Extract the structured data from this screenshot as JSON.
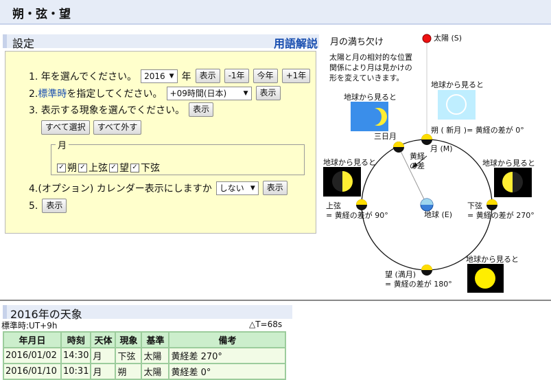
{
  "page": {
    "title": "朔・弦・望"
  },
  "settings": {
    "heading": "設定",
    "glossary_link": "用語解説",
    "step1": {
      "text": "1. 年を選んでください。",
      "year_value": "2016",
      "year_unit": "年",
      "show": "表示",
      "minus1": "-1年",
      "this_year": "今年",
      "plus1": "+1年"
    },
    "step2": {
      "num": "2.",
      "link": "標準時",
      "text": "を指定してください。",
      "tz_value": "+09時間(日本)",
      "show": "表示"
    },
    "step3": {
      "text": "3. 表示する現象を選んでください。",
      "show": "表示",
      "select_all": "すべて選択",
      "deselect_all": "すべて外す",
      "group_legend": "月",
      "options": [
        "朔",
        "上弦",
        "望",
        "下弦"
      ],
      "checked": [
        true,
        true,
        true,
        true
      ]
    },
    "step4": {
      "text": "4.(オプション) カレンダー表示にしますか",
      "value": "しない",
      "show": "表示"
    },
    "step5": {
      "num": "5.",
      "show": "表示"
    }
  },
  "diagram": {
    "title": "月の満ち欠け",
    "desc": [
      "太陽と月の相対的な位置",
      "関係により月は見かけの",
      "形を変えていきます。"
    ],
    "sun_label": "太陽 (S)",
    "view_from_earth": "地球から見ると",
    "new_moon": "朔 ( 新月 )= 黄経の差が 0°",
    "moon_label": "月 (M)",
    "crescent": "三日月",
    "ecl_diff": [
      "黄経",
      "の差"
    ],
    "first_quarter": [
      "上弦",
      "= 黄経の差が 90°"
    ],
    "last_quarter": [
      "下弦",
      "= 黄経の差が 270°"
    ],
    "earth_label": "地球 (E)",
    "full_moon": [
      "望 (満月)",
      "= 黄経の差が 180°"
    ]
  },
  "events": {
    "heading": "2016年の天象",
    "std_time": "標準時:UT+9h",
    "delta_t": "△T=68s",
    "columns": [
      "年月日",
      "時刻",
      "天体",
      "現象",
      "基準",
      "備考"
    ],
    "rows": [
      [
        "2016/01/02",
        "14:30",
        "月",
        "下弦",
        "太陽",
        "黄経差 270°"
      ],
      [
        "2016/01/10",
        "10:31",
        "月",
        "朔",
        "太陽",
        "黄経差 0°"
      ]
    ]
  }
}
